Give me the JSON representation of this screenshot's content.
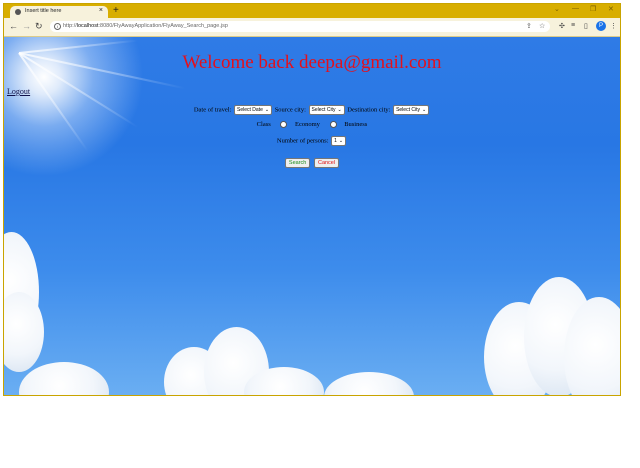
{
  "browser": {
    "tab_title": "Insert title here",
    "tab_close": "×",
    "new_tab": "+",
    "url_host": "localhost",
    "url_rest": ":8080/FlyAwayApplication/FlyAway_Search_page.jsp",
    "url_prefix": "http://",
    "profile_initial": "P",
    "window_controls": [
      "⌄",
      "—",
      "❐",
      "✕"
    ]
  },
  "page": {
    "welcome": "Welcome back deepa@gmail.com",
    "logout": "Logout",
    "travel_label": "Date of travel:",
    "travel_value": "Select Date",
    "source_label": "Source city:",
    "source_value": "Select City",
    "dest_label": "Destination city:",
    "dest_value": "Select City",
    "class_label": "Class",
    "class_options": [
      "Economy",
      "Business"
    ],
    "persons_label": "Number of persons:",
    "persons_value": "1",
    "search_button": "Search",
    "cancel_button": "Cancel"
  },
  "colors": {
    "title": "#e4101c",
    "chrome_frame": "#d8ae00",
    "sky": "#2877e4"
  }
}
